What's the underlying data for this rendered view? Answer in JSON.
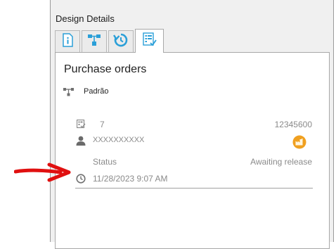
{
  "panel": {
    "title": "Design Details",
    "tabs": [
      {
        "icon": "info-icon",
        "active": false
      },
      {
        "icon": "workflow-icon",
        "active": false
      },
      {
        "icon": "history-icon",
        "active": false
      },
      {
        "icon": "checklist-icon",
        "active": true
      }
    ]
  },
  "card": {
    "title": "Purchase orders",
    "workflow_label": "Padrão",
    "number": "7",
    "code": "12345600",
    "user": "XXXXXXXXXX",
    "status_label": "Status",
    "status_value": "Awaiting release",
    "timestamp": "11/28/2023 9:07 AM"
  },
  "colors": {
    "accent_blue": "#2a9fd8",
    "arrow_red": "#e01010",
    "badge_orange": "#f0a020",
    "muted_text": "#8a8a8a"
  }
}
